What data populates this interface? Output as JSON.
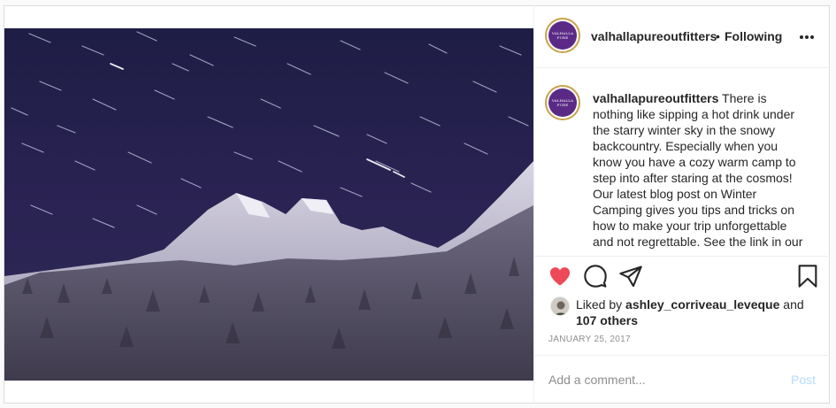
{
  "post": {
    "username": "valhallapureoutfitters",
    "separator": "•",
    "follow_status": "Following",
    "avatar_text": "VALHALLA PURE",
    "caption": "There is nothing like sipping a hot drink under the starry winter sky in the snowy backcountry. Especially when you know you have a cozy warm camp to step into after staring at the cosmos! Our latest blog post on Winter Camping gives you tips and tricks on how to make your trip unforgettable and not regrettable. See the link in our",
    "likes": {
      "prefix": "Liked by",
      "liker": "ashley_corriveau_leveque",
      "and": "and",
      "others": "107 others"
    },
    "date": "JANUARY 25, 2017",
    "comment_placeholder": "Add a comment...",
    "post_label": "Post"
  },
  "icons": {
    "like": "heart-icon",
    "comment": "comment-icon",
    "share": "paper-plane-icon",
    "save": "bookmark-icon",
    "more": "more-options-icon"
  },
  "colors": {
    "like_active": "#ed4956",
    "post_button_disabled": "#b3dbff",
    "avatar_brand": "#5b2a86",
    "avatar_ring": "#c9a24a",
    "meta_text": "#8e8e8e"
  }
}
